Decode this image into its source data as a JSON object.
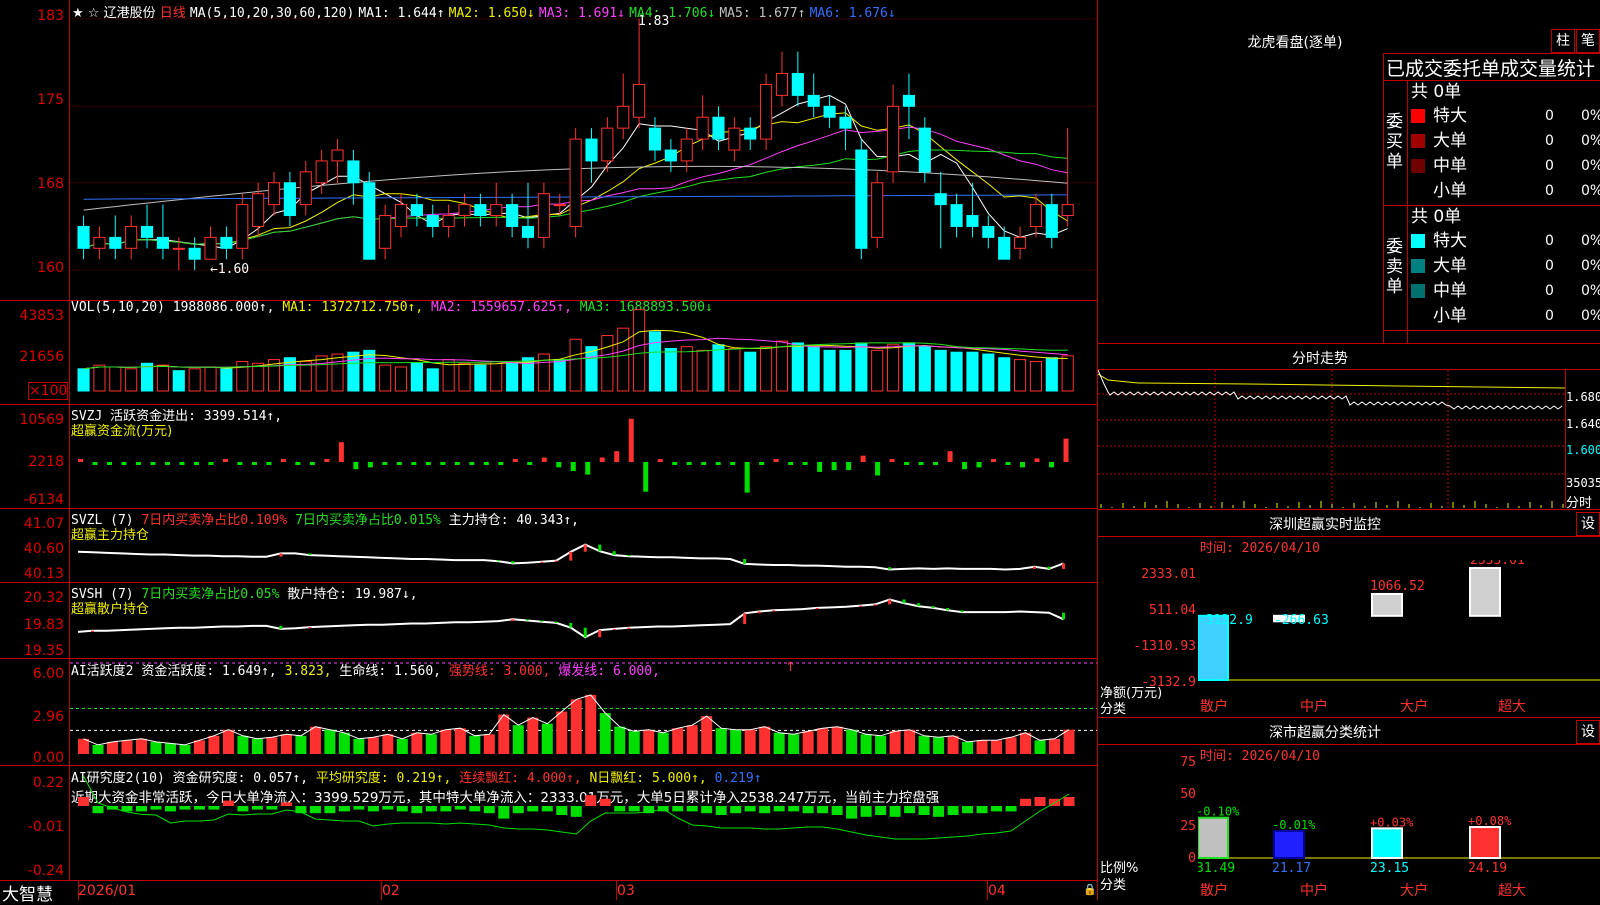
{
  "main_chart": {
    "stock_name": "辽港股份",
    "period": "日线",
    "ma_header": "MA(5,10,20,30,60,120)",
    "ma": [
      {
        "label": "MA1: 1.644↑",
        "color": "#ffffff"
      },
      {
        "label": "MA2: 1.650↓",
        "color": "#f0f000"
      },
      {
        "label": "MA3: 1.691↓",
        "color": "#ff40ff"
      },
      {
        "label": "MA4: 1.706↓",
        "color": "#20e020"
      },
      {
        "label": "MA5: 1.677↑",
        "color": "#c0c0c0"
      },
      {
        "label": "MA6: 1.676↓",
        "color": "#3070ff"
      }
    ],
    "y_ticks": [
      "183",
      "175",
      "168",
      "160"
    ],
    "high_mark": "1.83",
    "low_mark": "←1.60",
    "candles": [
      {
        "o": 1.64,
        "c": 1.62,
        "h": 1.65,
        "l": 1.61
      },
      {
        "o": 1.62,
        "c": 1.63,
        "h": 1.64,
        "l": 1.61
      },
      {
        "o": 1.63,
        "c": 1.62,
        "h": 1.65,
        "l": 1.61
      },
      {
        "o": 1.62,
        "c": 1.64,
        "h": 1.65,
        "l": 1.61
      },
      {
        "o": 1.64,
        "c": 1.63,
        "h": 1.66,
        "l": 1.62
      },
      {
        "o": 1.63,
        "c": 1.62,
        "h": 1.66,
        "l": 1.61
      },
      {
        "o": 1.62,
        "c": 1.62,
        "h": 1.63,
        "l": 1.6
      },
      {
        "o": 1.62,
        "c": 1.61,
        "h": 1.63,
        "l": 1.6
      },
      {
        "o": 1.61,
        "c": 1.63,
        "h": 1.64,
        "l": 1.61
      },
      {
        "o": 1.63,
        "c": 1.62,
        "h": 1.64,
        "l": 1.61
      },
      {
        "o": 1.62,
        "c": 1.66,
        "h": 1.67,
        "l": 1.61
      },
      {
        "o": 1.64,
        "c": 1.67,
        "h": 1.68,
        "l": 1.63
      },
      {
        "o": 1.66,
        "c": 1.68,
        "h": 1.69,
        "l": 1.65
      },
      {
        "o": 1.68,
        "c": 1.65,
        "h": 1.69,
        "l": 1.64
      },
      {
        "o": 1.66,
        "c": 1.69,
        "h": 1.7,
        "l": 1.65
      },
      {
        "o": 1.68,
        "c": 1.7,
        "h": 1.71,
        "l": 1.67
      },
      {
        "o": 1.7,
        "c": 1.71,
        "h": 1.72,
        "l": 1.68
      },
      {
        "o": 1.7,
        "c": 1.68,
        "h": 1.71,
        "l": 1.66
      },
      {
        "o": 1.68,
        "c": 1.61,
        "h": 1.69,
        "l": 1.61
      },
      {
        "o": 1.62,
        "c": 1.65,
        "h": 1.66,
        "l": 1.61
      },
      {
        "o": 1.64,
        "c": 1.66,
        "h": 1.67,
        "l": 1.63
      },
      {
        "o": 1.66,
        "c": 1.65,
        "h": 1.67,
        "l": 1.64
      },
      {
        "o": 1.65,
        "c": 1.64,
        "h": 1.66,
        "l": 1.63
      },
      {
        "o": 1.64,
        "c": 1.65,
        "h": 1.66,
        "l": 1.63
      },
      {
        "o": 1.65,
        "c": 1.66,
        "h": 1.67,
        "l": 1.64
      },
      {
        "o": 1.66,
        "c": 1.65,
        "h": 1.67,
        "l": 1.64
      },
      {
        "o": 1.65,
        "c": 1.66,
        "h": 1.68,
        "l": 1.64
      },
      {
        "o": 1.66,
        "c": 1.64,
        "h": 1.67,
        "l": 1.63
      },
      {
        "o": 1.64,
        "c": 1.63,
        "h": 1.68,
        "l": 1.62
      },
      {
        "o": 1.63,
        "c": 1.67,
        "h": 1.68,
        "l": 1.62
      },
      {
        "o": 1.66,
        "c": 1.66,
        "h": 1.67,
        "l": 1.65
      },
      {
        "o": 1.64,
        "c": 1.72,
        "h": 1.73,
        "l": 1.63
      },
      {
        "o": 1.72,
        "c": 1.7,
        "h": 1.73,
        "l": 1.68
      },
      {
        "o": 1.7,
        "c": 1.73,
        "h": 1.74,
        "l": 1.69
      },
      {
        "o": 1.73,
        "c": 1.75,
        "h": 1.78,
        "l": 1.72
      },
      {
        "o": 1.74,
        "c": 1.77,
        "h": 1.83,
        "l": 1.73
      },
      {
        "o": 1.73,
        "c": 1.71,
        "h": 1.74,
        "l": 1.7
      },
      {
        "o": 1.71,
        "c": 1.7,
        "h": 1.72,
        "l": 1.69
      },
      {
        "o": 1.7,
        "c": 1.72,
        "h": 1.73,
        "l": 1.69
      },
      {
        "o": 1.72,
        "c": 1.74,
        "h": 1.76,
        "l": 1.71
      },
      {
        "o": 1.74,
        "c": 1.72,
        "h": 1.75,
        "l": 1.71
      },
      {
        "o": 1.71,
        "c": 1.73,
        "h": 1.74,
        "l": 1.7
      },
      {
        "o": 1.73,
        "c": 1.72,
        "h": 1.74,
        "l": 1.71
      },
      {
        "o": 1.72,
        "c": 1.77,
        "h": 1.78,
        "l": 1.71
      },
      {
        "o": 1.76,
        "c": 1.78,
        "h": 1.8,
        "l": 1.75
      },
      {
        "o": 1.78,
        "c": 1.76,
        "h": 1.8,
        "l": 1.75
      },
      {
        "o": 1.76,
        "c": 1.75,
        "h": 1.78,
        "l": 1.74
      },
      {
        "o": 1.75,
        "c": 1.74,
        "h": 1.76,
        "l": 1.73
      },
      {
        "o": 1.74,
        "c": 1.73,
        "h": 1.75,
        "l": 1.71
      },
      {
        "o": 1.71,
        "c": 1.62,
        "h": 1.72,
        "l": 1.61
      },
      {
        "o": 1.63,
        "c": 1.68,
        "h": 1.69,
        "l": 1.62
      },
      {
        "o": 1.69,
        "c": 1.75,
        "h": 1.77,
        "l": 1.68
      },
      {
        "o": 1.76,
        "c": 1.75,
        "h": 1.78,
        "l": 1.72
      },
      {
        "o": 1.73,
        "c": 1.69,
        "h": 1.74,
        "l": 1.68
      },
      {
        "o": 1.67,
        "c": 1.66,
        "h": 1.69,
        "l": 1.62
      },
      {
        "o": 1.66,
        "c": 1.64,
        "h": 1.67,
        "l": 1.63
      },
      {
        "o": 1.65,
        "c": 1.64,
        "h": 1.68,
        "l": 1.63
      },
      {
        "o": 1.64,
        "c": 1.63,
        "h": 1.65,
        "l": 1.62
      },
      {
        "o": 1.63,
        "c": 1.61,
        "h": 1.64,
        "l": 1.61
      },
      {
        "o": 1.62,
        "c": 1.63,
        "h": 1.64,
        "l": 1.61
      },
      {
        "o": 1.64,
        "c": 1.66,
        "h": 1.67,
        "l": 1.63
      },
      {
        "o": 1.66,
        "c": 1.63,
        "h": 1.67,
        "l": 1.62
      },
      {
        "o": 1.65,
        "c": 1.66,
        "h": 1.73,
        "l": 1.64
      }
    ]
  },
  "vol": {
    "title": "VOL(5,10,20)",
    "value": "1988086.000↑,",
    "ma1": "MA1: 1372712.750↑,",
    "ma2": "MA2: 1559657.625↑,",
    "ma3": "MA3: 1688893.500↓",
    "y_ticks": [
      "43853",
      "21656",
      "×100"
    ],
    "bars": [
      12,
      14,
      13,
      12,
      15,
      14,
      11,
      12,
      13,
      12,
      16,
      15,
      17,
      18,
      16,
      19,
      20,
      21,
      22,
      14,
      13,
      15,
      12,
      17,
      15,
      14,
      16,
      15,
      18,
      20,
      17,
      28,
      24,
      30,
      34,
      44,
      32,
      23,
      24,
      22,
      25,
      23,
      21,
      24,
      27,
      26,
      24,
      22,
      22,
      26,
      22,
      25,
      26,
      24,
      22,
      21,
      21,
      20,
      18,
      17,
      16,
      18,
      19
    ],
    "up": [
      false,
      true,
      true,
      true,
      false,
      true,
      false,
      true,
      true,
      false,
      true,
      true,
      true,
      false,
      true,
      true,
      true,
      false,
      false,
      true,
      true,
      false,
      false,
      true,
      true,
      false,
      true,
      false,
      false,
      true,
      false,
      true,
      false,
      true,
      true,
      true,
      false,
      false,
      true,
      true,
      false,
      true,
      false,
      true,
      true,
      false,
      false,
      false,
      false,
      false,
      true,
      true,
      false,
      false,
      false,
      false,
      false,
      false,
      false,
      true,
      true,
      false,
      true
    ]
  },
  "svzj": {
    "title": "SVZJ",
    "text": "活跃资金进出: 3399.514↑,",
    "subtitle": "超赢资金流(万元)",
    "y_ticks": [
      "10569",
      "2218",
      "-6134"
    ],
    "values": [
      0.3,
      -0.2,
      -0.2,
      -0.2,
      -0.2,
      -0.2,
      -0.2,
      -0.2,
      -0.2,
      -0.2,
      0.3,
      -0.2,
      -0.2,
      -0.2,
      0.2,
      -0.2,
      -0.2,
      0.3,
      2.2,
      -0.8,
      -0.6,
      -0.2,
      -0.2,
      -0.2,
      -0.2,
      -0.2,
      -0.2,
      -0.2,
      -0.2,
      -0.2,
      0.3,
      -0.2,
      0.5,
      -0.6,
      -1.0,
      -1.4,
      0.5,
      1.2,
      4.8,
      -3.3,
      0.3,
      -0.2,
      -0.2,
      -0.2,
      -0.2,
      -0.2,
      -3.4,
      -0.3,
      0.2,
      -0.2,
      -0.2,
      -1.1,
      -0.9,
      -0.9,
      0.7,
      -1.5,
      0.3,
      -0.2,
      -0.2,
      -0.2,
      1.2,
      -0.8,
      -0.6,
      0.3,
      -0.2,
      -0.6,
      0.4,
      -0.6,
      2.6
    ]
  },
  "svzl": {
    "title": "SVZL (7)",
    "t1": "7日内买卖净占比0.109%",
    "t2": "7日内买卖净占比0.015%",
    "t3": "主力持仓: 40.343↑,",
    "subtitle": "超赢主力持仓",
    "y_ticks": [
      "41.07",
      "40.60",
      "40.13"
    ],
    "values": [
      40.55,
      40.54,
      40.53,
      40.52,
      40.51,
      40.5,
      40.5,
      40.49,
      40.48,
      40.48,
      40.47,
      40.47,
      40.46,
      40.46,
      40.52,
      40.52,
      40.49,
      40.48,
      40.47,
      40.46,
      40.45,
      40.44,
      40.43,
      40.42,
      40.42,
      40.41,
      40.4,
      40.4,
      40.4,
      40.38,
      40.34,
      40.35,
      40.37,
      40.39,
      40.55,
      40.68,
      40.56,
      40.49,
      40.47,
      40.46,
      40.45,
      40.45,
      40.44,
      40.43,
      40.43,
      40.42,
      40.33,
      40.32,
      40.31,
      40.31,
      40.3,
      40.3,
      40.29,
      40.28,
      40.28,
      40.27,
      40.23,
      40.24,
      40.25,
      40.24,
      40.25,
      40.24,
      40.24,
      40.24,
      40.23,
      40.24,
      40.28,
      40.24,
      40.34
    ]
  },
  "svsh": {
    "title": "SVSH (7)",
    "t1": "7日内买卖净占比0.05%",
    "t2": "散户持仓: 19.987↓,",
    "subtitle": "超赢散户持仓",
    "y_ticks": [
      "20.32",
      "19.83",
      "19.35"
    ],
    "values": [
      19.67,
      19.69,
      19.69,
      19.7,
      19.71,
      19.72,
      19.73,
      19.74,
      19.74,
      19.75,
      19.76,
      19.76,
      19.77,
      19.77,
      19.72,
      19.73,
      19.75,
      19.76,
      19.77,
      19.78,
      19.79,
      19.79,
      19.8,
      19.81,
      19.81,
      19.82,
      19.83,
      19.83,
      19.84,
      19.85,
      19.88,
      19.86,
      19.84,
      19.82,
      19.74,
      19.58,
      19.7,
      19.72,
      19.74,
      19.75,
      19.76,
      19.76,
      19.77,
      19.78,
      19.79,
      19.8,
      19.98,
      20.01,
      20.03,
      20.04,
      20.05,
      20.07,
      20.08,
      20.09,
      20.11,
      20.13,
      20.21,
      20.15,
      20.1,
      20.07,
      20.03,
      20.0,
      20.0,
      20.0,
      20.0,
      20.01,
      20.0,
      19.99,
      19.88
    ]
  },
  "ai_hyd": {
    "title": "AI活跃度2",
    "t1": "资金活跃度: 1.649↑,",
    "t2": "3.823,",
    "t3": "生命线: 1.560,",
    "t4": "强势线: 3.000,",
    "t5": "爆发线: 6.000,",
    "arrow": "↑",
    "y_ticks": [
      "6.00",
      "2.96",
      "0.00"
    ],
    "values": [
      1.0,
      0.6,
      0.8,
      0.9,
      1.0,
      0.8,
      0.7,
      0.6,
      0.9,
      1.2,
      1.6,
      1.2,
      1.0,
      1.1,
      1.3,
      1.2,
      1.8,
      1.6,
      1.4,
      1.0,
      1.1,
      1.3,
      1.0,
      1.4,
      1.3,
      1.6,
      1.7,
      1.2,
      1.3,
      2.6,
      1.9,
      2.4,
      2.0,
      2.8,
      3.6,
      3.9,
      2.7,
      1.8,
      1.5,
      1.6,
      1.4,
      1.7,
      1.9,
      2.5,
      1.7,
      1.6,
      1.6,
      1.8,
      1.4,
      1.3,
      1.5,
      1.7,
      1.8,
      1.6,
      1.3,
      1.2,
      1.5,
      1.6,
      1.2,
      1.1,
      1.2,
      0.8,
      0.9,
      0.9,
      1.1,
      1.4,
      0.9,
      1.0,
      1.6
    ]
  },
  "ai_yjd": {
    "title": "AI研究度2(10)",
    "t1": "资金研究度: 0.057↑,",
    "t2": "平均研究度: 0.219↑,",
    "t3": "连续飘红: 4.000↑,",
    "t4": "N日飘红: 5.000↑,",
    "t5": "0.219↑",
    "note": "近期大资金非常活跃，今日大单净流入：3399.529万元，其中特大单净流入：2333.01万元，大单5日累计净入2538.247万元，当前主力控盘强",
    "y_ticks": [
      "0.22",
      "-0.01",
      "-0.24"
    ],
    "values": [
      0.05,
      -0.04,
      -0.02,
      -0.03,
      -0.03,
      -0.02,
      -0.03,
      -0.02,
      -0.02,
      -0.02,
      0.03,
      -0.03,
      -0.02,
      -0.02,
      0.02,
      -0.04,
      -0.04,
      -0.04,
      -0.03,
      -0.02,
      -0.03,
      -0.02,
      -0.03,
      -0.04,
      -0.03,
      -0.03,
      -0.02,
      -0.03,
      -0.04,
      -0.07,
      -0.04,
      -0.03,
      -0.03,
      -0.05,
      -0.06,
      0.06,
      0.04,
      -0.03,
      -0.03,
      -0.04,
      -0.03,
      -0.03,
      -0.03,
      -0.04,
      -0.05,
      -0.04,
      -0.03,
      -0.04,
      -0.03,
      -0.03,
      -0.04,
      -0.04,
      -0.05,
      -0.07,
      -0.06,
      -0.05,
      -0.06,
      -0.04,
      -0.05,
      -0.06,
      -0.05,
      -0.04,
      -0.04,
      -0.03,
      -0.03,
      0.04,
      0.05,
      0.04,
      0.05
    ]
  },
  "x_axis": {
    "labels": [
      "2026/01",
      "02",
      "03",
      "04"
    ],
    "brand": "大智慧"
  },
  "longhu": {
    "title": "龙虎看盘(逐单)",
    "btn1": "柱",
    "btn2": "笔",
    "header": "已成交委托单成交量统计",
    "buy": {
      "label": "委买单",
      "total": "共 0单",
      "rows": [
        {
          "name": "特大",
          "n": "0",
          "pct": "0%",
          "color": "#ff0000"
        },
        {
          "name": "大单",
          "n": "0",
          "pct": "0%",
          "color": "#a00000"
        },
        {
          "name": "中单",
          "n": "0",
          "pct": "0%",
          "color": "#700000"
        },
        {
          "name": "小单",
          "n": "0",
          "pct": "0%",
          "color": "#000000"
        }
      ]
    },
    "sell": {
      "label": "委卖单",
      "total": "共 0单",
      "rows": [
        {
          "name": "特大",
          "n": "0",
          "pct": "0%",
          "color": "#00ffff"
        },
        {
          "name": "大单",
          "n": "0",
          "pct": "0%",
          "color": "#008080"
        },
        {
          "name": "中单",
          "n": "0",
          "pct": "0%",
          "color": "#007070"
        },
        {
          "name": "小单",
          "n": "0",
          "pct": "0%",
          "color": "#000000"
        }
      ]
    }
  },
  "fenshi": {
    "title": "分时走势",
    "y_ticks": [
      "1.680",
      "1.640",
      "1.600",
      "35035"
    ],
    "bottom_label": "分时"
  },
  "sz_monitor": {
    "title": "深圳超赢实时监控",
    "btn": "设",
    "time": "时间: 2026/04/10",
    "y_ticks": [
      "2333.01",
      "511.04",
      "-1310.93",
      "-3132.9"
    ],
    "y_name": "净额(万元)",
    "x_name": "分类",
    "cats": [
      "散户",
      "中户",
      "大户",
      "超大"
    ],
    "values": [
      -3132.9,
      -266.63,
      1066.52,
      2333.01
    ],
    "value_labels": [
      "-3132.9",
      "-266.63",
      "1066.52",
      "2333.01"
    ]
  },
  "sz_class": {
    "title": "深市超赢分类统计",
    "btn": "设",
    "time": "时间: 2026/04/10",
    "y_ticks": [
      "75",
      "50",
      "25",
      "0"
    ],
    "y_name": "比例%",
    "x_name": "分类",
    "cats": [
      "散户",
      "中户",
      "大户",
      "超大"
    ],
    "values": [
      31.49,
      21.17,
      23.15,
      24.19
    ],
    "changes": [
      "-0.10%",
      "-0.01%",
      "+0.03%",
      "+0.08%"
    ],
    "value_labels": [
      "31.49",
      "21.17",
      "23.15",
      "24.19"
    ]
  }
}
